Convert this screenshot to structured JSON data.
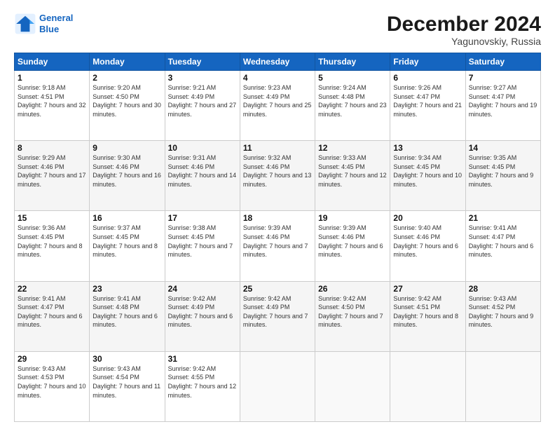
{
  "header": {
    "logo_line1": "General",
    "logo_line2": "Blue",
    "month": "December 2024",
    "location": "Yagunovskiy, Russia"
  },
  "days_of_week": [
    "Sunday",
    "Monday",
    "Tuesday",
    "Wednesday",
    "Thursday",
    "Friday",
    "Saturday"
  ],
  "weeks": [
    [
      {
        "num": "1",
        "rise": "9:18 AM",
        "set": "4:51 PM",
        "daylight": "7 hours and 32 minutes."
      },
      {
        "num": "2",
        "rise": "9:20 AM",
        "set": "4:50 PM",
        "daylight": "7 hours and 30 minutes."
      },
      {
        "num": "3",
        "rise": "9:21 AM",
        "set": "4:49 PM",
        "daylight": "7 hours and 27 minutes."
      },
      {
        "num": "4",
        "rise": "9:23 AM",
        "set": "4:49 PM",
        "daylight": "7 hours and 25 minutes."
      },
      {
        "num": "5",
        "rise": "9:24 AM",
        "set": "4:48 PM",
        "daylight": "7 hours and 23 minutes."
      },
      {
        "num": "6",
        "rise": "9:26 AM",
        "set": "4:47 PM",
        "daylight": "7 hours and 21 minutes."
      },
      {
        "num": "7",
        "rise": "9:27 AM",
        "set": "4:47 PM",
        "daylight": "7 hours and 19 minutes."
      }
    ],
    [
      {
        "num": "8",
        "rise": "9:29 AM",
        "set": "4:46 PM",
        "daylight": "7 hours and 17 minutes."
      },
      {
        "num": "9",
        "rise": "9:30 AM",
        "set": "4:46 PM",
        "daylight": "7 hours and 16 minutes."
      },
      {
        "num": "10",
        "rise": "9:31 AM",
        "set": "4:46 PM",
        "daylight": "7 hours and 14 minutes."
      },
      {
        "num": "11",
        "rise": "9:32 AM",
        "set": "4:46 PM",
        "daylight": "7 hours and 13 minutes."
      },
      {
        "num": "12",
        "rise": "9:33 AM",
        "set": "4:45 PM",
        "daylight": "7 hours and 12 minutes."
      },
      {
        "num": "13",
        "rise": "9:34 AM",
        "set": "4:45 PM",
        "daylight": "7 hours and 10 minutes."
      },
      {
        "num": "14",
        "rise": "9:35 AM",
        "set": "4:45 PM",
        "daylight": "7 hours and 9 minutes."
      }
    ],
    [
      {
        "num": "15",
        "rise": "9:36 AM",
        "set": "4:45 PM",
        "daylight": "7 hours and 8 minutes."
      },
      {
        "num": "16",
        "rise": "9:37 AM",
        "set": "4:45 PM",
        "daylight": "7 hours and 8 minutes."
      },
      {
        "num": "17",
        "rise": "9:38 AM",
        "set": "4:45 PM",
        "daylight": "7 hours and 7 minutes."
      },
      {
        "num": "18",
        "rise": "9:39 AM",
        "set": "4:46 PM",
        "daylight": "7 hours and 7 minutes."
      },
      {
        "num": "19",
        "rise": "9:39 AM",
        "set": "4:46 PM",
        "daylight": "7 hours and 6 minutes."
      },
      {
        "num": "20",
        "rise": "9:40 AM",
        "set": "4:46 PM",
        "daylight": "7 hours and 6 minutes."
      },
      {
        "num": "21",
        "rise": "9:41 AM",
        "set": "4:47 PM",
        "daylight": "7 hours and 6 minutes."
      }
    ],
    [
      {
        "num": "22",
        "rise": "9:41 AM",
        "set": "4:47 PM",
        "daylight": "7 hours and 6 minutes."
      },
      {
        "num": "23",
        "rise": "9:41 AM",
        "set": "4:48 PM",
        "daylight": "7 hours and 6 minutes."
      },
      {
        "num": "24",
        "rise": "9:42 AM",
        "set": "4:49 PM",
        "daylight": "7 hours and 6 minutes."
      },
      {
        "num": "25",
        "rise": "9:42 AM",
        "set": "4:49 PM",
        "daylight": "7 hours and 7 minutes."
      },
      {
        "num": "26",
        "rise": "9:42 AM",
        "set": "4:50 PM",
        "daylight": "7 hours and 7 minutes."
      },
      {
        "num": "27",
        "rise": "9:42 AM",
        "set": "4:51 PM",
        "daylight": "7 hours and 8 minutes."
      },
      {
        "num": "28",
        "rise": "9:43 AM",
        "set": "4:52 PM",
        "daylight": "7 hours and 9 minutes."
      }
    ],
    [
      {
        "num": "29",
        "rise": "9:43 AM",
        "set": "4:53 PM",
        "daylight": "7 hours and 10 minutes."
      },
      {
        "num": "30",
        "rise": "9:43 AM",
        "set": "4:54 PM",
        "daylight": "7 hours and 11 minutes."
      },
      {
        "num": "31",
        "rise": "9:42 AM",
        "set": "4:55 PM",
        "daylight": "7 hours and 12 minutes."
      },
      null,
      null,
      null,
      null
    ]
  ]
}
